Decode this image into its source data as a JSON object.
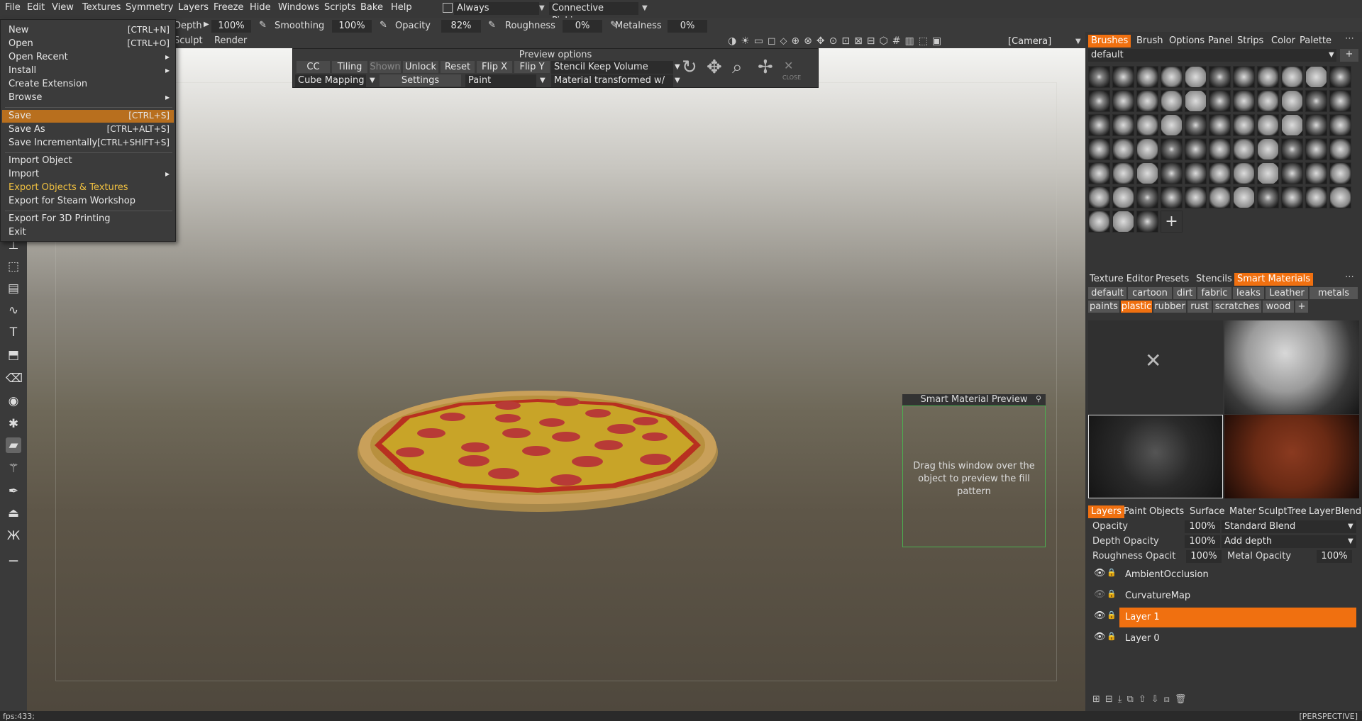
{
  "menubar": {
    "items": [
      "File",
      "Edit",
      "View",
      "Textures",
      "Symmetry",
      "Layers",
      "Freeze",
      "Hide",
      "Windows",
      "Scripts",
      "Bake",
      "Help"
    ],
    "always_check_label": "Always",
    "picking_label": "Connective Picking"
  },
  "toolbar": {
    "depth_label": "Depth",
    "depth_value": "100%",
    "smoothing_label": "Smoothing",
    "smoothing_value": "100%",
    "opacity_label": "Opacity",
    "opacity_value": "82%",
    "roughness_label": "Roughness",
    "roughness_value": "0%",
    "metalness_label": "Metalness",
    "metalness_value": "0%"
  },
  "row3": {
    "sculpt_label": "Sculpt",
    "render_label": "Render",
    "camera_label": "[Camera]"
  },
  "file_menu": {
    "items": [
      {
        "label": "New",
        "shortcut": "[CTRL+N]",
        "arrow": ""
      },
      {
        "label": "Open",
        "shortcut": "[CTRL+O]",
        "arrow": ""
      },
      {
        "label": "Open Recent",
        "shortcut": "",
        "arrow": "▸"
      },
      {
        "label": "Install",
        "shortcut": "",
        "arrow": "▸"
      },
      {
        "label": "Create Extension",
        "shortcut": "",
        "arrow": ""
      },
      {
        "label": "Browse",
        "shortcut": "",
        "arrow": "▸"
      },
      {
        "label": "Save",
        "shortcut": "[CTRL+S]",
        "arrow": ""
      },
      {
        "label": "Save As",
        "shortcut": "[CTRL+ALT+S]",
        "arrow": ""
      },
      {
        "label": "Save Incrementally",
        "shortcut": "[CTRL+SHIFT+S]",
        "arrow": ""
      },
      {
        "label": "Import Object",
        "shortcut": "",
        "arrow": ""
      },
      {
        "label": "Import",
        "shortcut": "",
        "arrow": "▸"
      },
      {
        "label": "Export Objects & Textures",
        "shortcut": "",
        "arrow": ""
      },
      {
        "label": "Export for Steam Workshop",
        "shortcut": "",
        "arrow": ""
      },
      {
        "label": "Export For 3D Printing",
        "shortcut": "",
        "arrow": ""
      },
      {
        "label": "Exit",
        "shortcut": "",
        "arrow": ""
      }
    ]
  },
  "preview_options": {
    "title": "Preview options",
    "cc_label": "CC",
    "tiling_label": "Tiling",
    "shown_label": "Shown",
    "unlock_label": "Unlock",
    "reset_label": "Reset",
    "flipx_label": "Flip X",
    "flipy_label": "Flip Y",
    "stencil_mode": "Stencil Keep Volume",
    "mapping": "Cube Mapping",
    "settings_label": "Settings",
    "paint_mode": "Paint",
    "material_mode": "Material transformed w/",
    "close_label": "CLOSE"
  },
  "right_panel": {
    "tabs1": [
      "Brushes",
      "Brush",
      "Options",
      "Panel",
      "Strips",
      "Color",
      "Palette"
    ],
    "brush_set": "default",
    "tabs2": [
      "Texture Editor",
      "Presets",
      "Stencils",
      "Smart Materials"
    ],
    "categories_row1": [
      "default",
      "cartoon",
      "dirt",
      "fabric",
      "leaks",
      "Leather",
      "metals"
    ],
    "categories_row2": [
      "paints",
      "plastic",
      "rubber",
      "rust",
      "scratches",
      "wood"
    ],
    "tabs3": [
      "Layers",
      "Paint",
      "Objects",
      "Surface",
      "Mater",
      "SculptTree",
      "Layer",
      "Blendin"
    ],
    "opacity_label": "Opacity",
    "opacity_value": "100%",
    "blend_mode": "Standard Blend",
    "depth_opacity_label": "Depth Opacity",
    "depth_opacity_value": "100%",
    "depth_mode": "Add depth",
    "roughness_opacity_label": "Roughness Opacit",
    "roughness_opacity_value": "100%",
    "metal_opacity_label": "Metal Opacity",
    "metal_opacity_value": "100%",
    "layers": [
      {
        "name": "AmbientOcclusion",
        "active": false,
        "visible": true
      },
      {
        "name": "CurvatureMap",
        "active": false,
        "visible": false
      },
      {
        "name": "Layer 1",
        "active": true,
        "visible": true
      },
      {
        "name": "Layer 0",
        "active": false,
        "visible": true
      }
    ]
  },
  "smart_material_preview": {
    "title": "Smart Material Preview",
    "hint": "Drag this window over the object to preview the fill pattern"
  },
  "status": {
    "fps": "fps:433;",
    "view": "[PERSPECTIVE]"
  },
  "colors": {
    "accent": "#f07010",
    "menu_highlight": "#b86f1e",
    "gold_text": "#f0c040"
  }
}
